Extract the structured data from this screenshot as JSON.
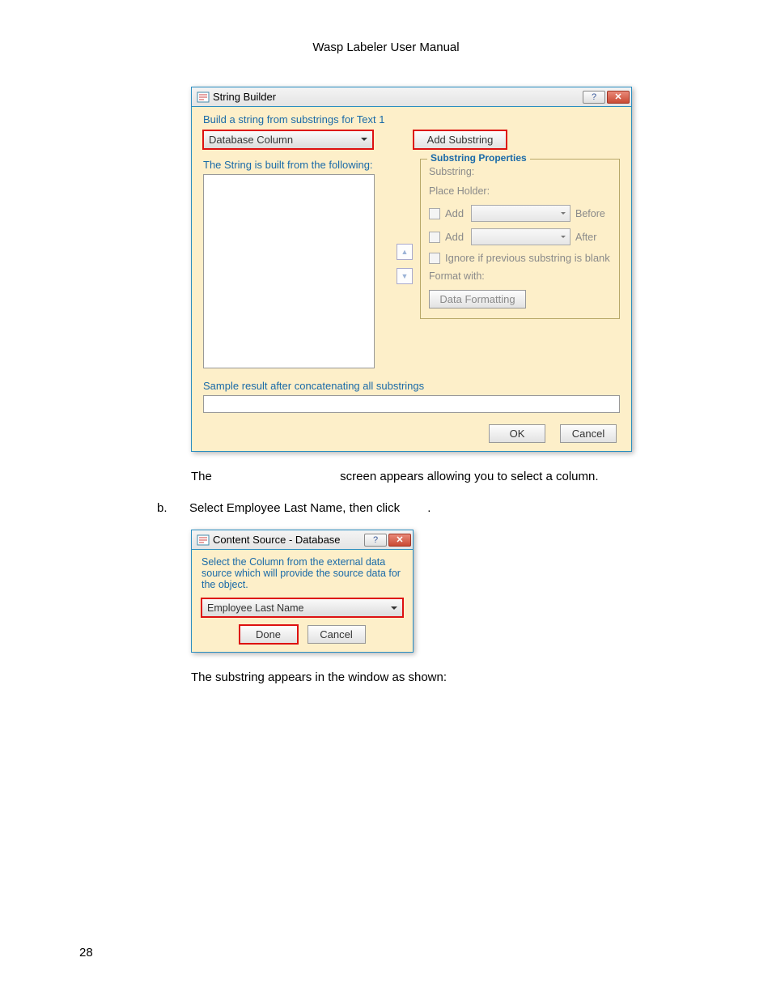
{
  "header": "Wasp Labeler User Manual",
  "dialog1": {
    "title": "String Builder",
    "instruction": "Build a string from substrings for Text 1",
    "source_dropdown": "Database Column",
    "add_substring_btn": "Add Substring",
    "list_label": "The String is built from the following:",
    "groupbox": {
      "title": "Substring Properties",
      "substring_label": "Substring:",
      "placeholder_label": "Place Holder:",
      "add_label": "Add",
      "before_label": "Before",
      "after_label": "After",
      "ignore_label": "Ignore if previous substring is blank",
      "format_label": "Format with:",
      "data_formatting_btn": "Data Formatting"
    },
    "sample_label": "Sample result after concatenating all substrings",
    "ok_btn": "OK",
    "cancel_btn": "Cancel"
  },
  "body_text_1a": "The ",
  "body_text_1b": " screen appears allowing you to select a column.",
  "step_b": {
    "marker": "b.",
    "text_1": "Select Employee Last Name, then click ",
    "text_2": "."
  },
  "dialog2": {
    "title": "Content Source - Database",
    "instruction": "Select the Column from the external data source which will provide the source data for the object.",
    "dropdown": "Employee Last Name",
    "done_btn": "Done",
    "cancel_btn": "Cancel"
  },
  "body_text_2": "The substring appears in the window as shown:",
  "page_number": "28"
}
